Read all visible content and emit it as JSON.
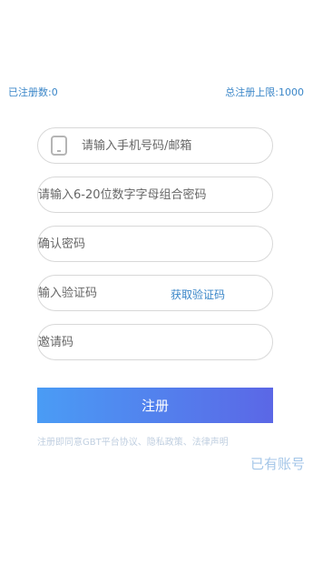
{
  "stats": {
    "registered": "已注册数:0",
    "limit": "总注册上限:1000"
  },
  "form": {
    "phone_placeholder": "请输入手机号码/邮箱",
    "password_placeholder": "请输入6-20位数字字母组合密码",
    "confirm_placeholder": "确认密码",
    "code_placeholder": "输入验证码",
    "get_code_label": "获取验证码",
    "invite_placeholder": "邀请码",
    "phone_icon": "phone-icon"
  },
  "register_button": "注册",
  "agreement": {
    "prefix": "注册即同意GBT平台协议、",
    "privacy": "隐私政策",
    "separator": "、",
    "legal": "法律声明"
  },
  "login_link": "已有账号",
  "colors": {
    "accent": "#3a86c8",
    "button_start": "#4a9cf5",
    "button_end": "#5b67e6",
    "muted": "#a4c6e8"
  }
}
